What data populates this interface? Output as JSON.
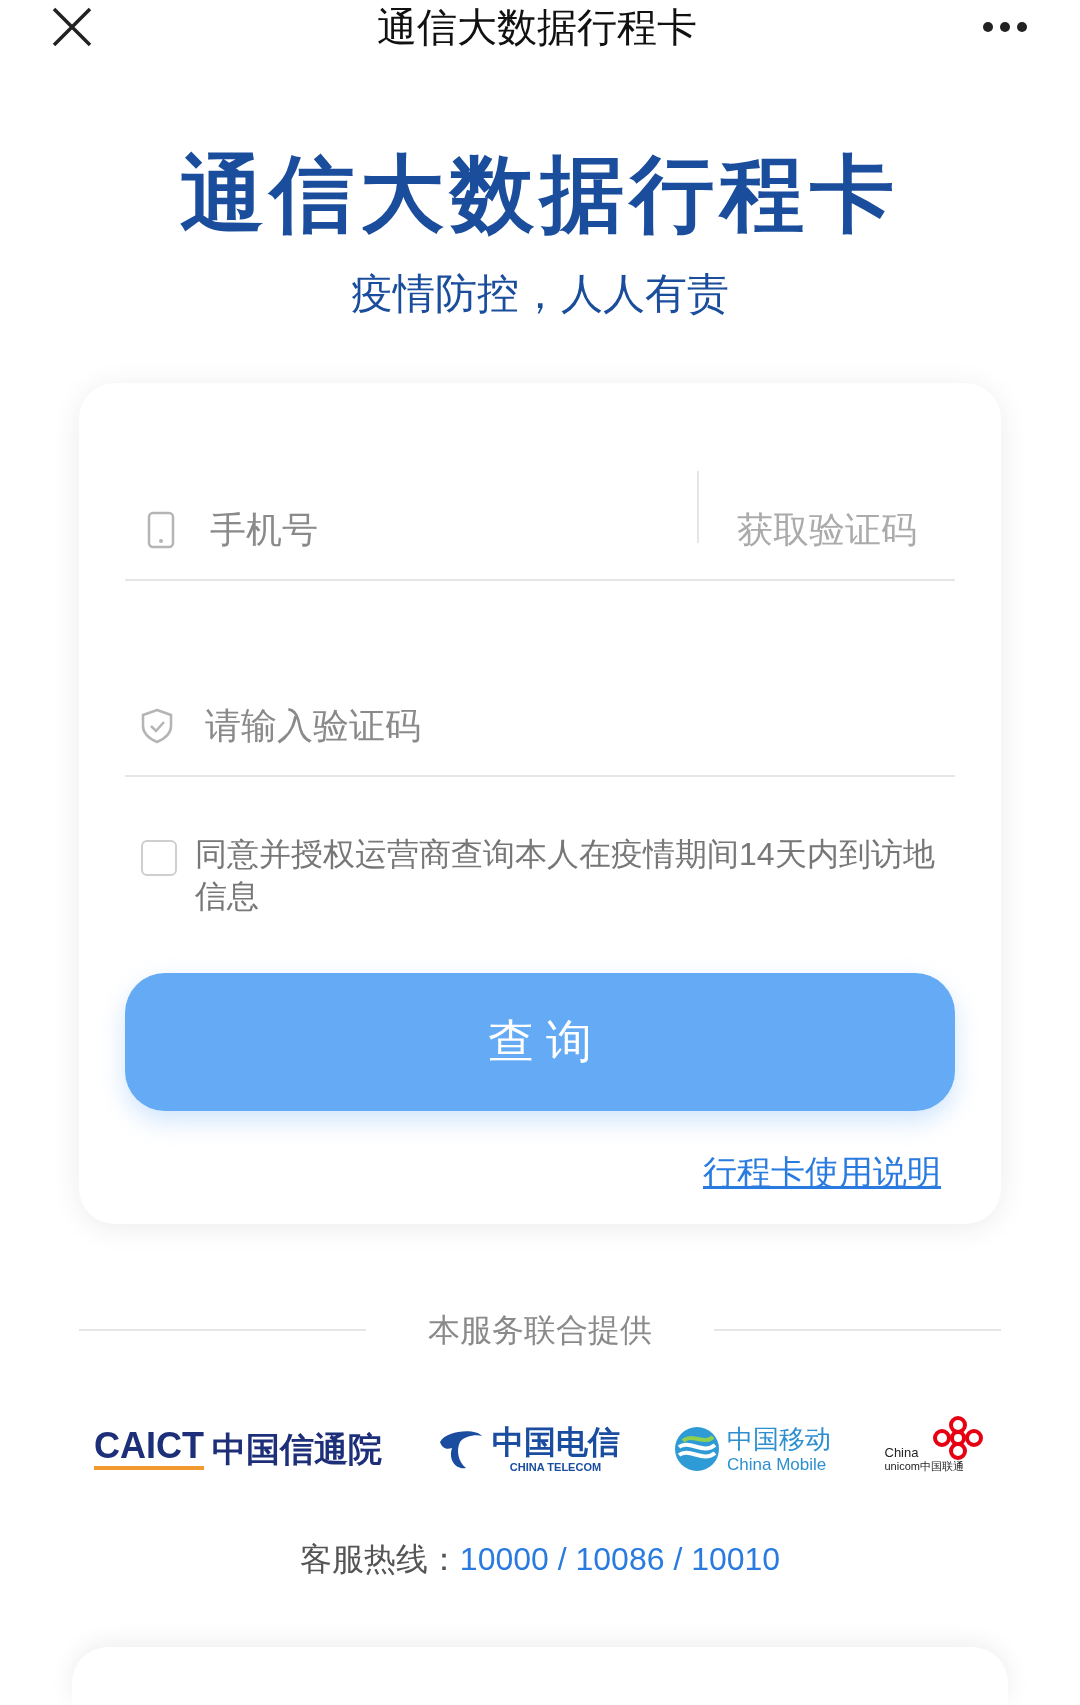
{
  "top_bar": {
    "title": "通信大数据行程卡"
  },
  "header": {
    "title": "通信大数据行程卡",
    "slogan": "疫情防控，人人有责"
  },
  "form": {
    "phone_field": {
      "placeholder": "手机号"
    },
    "get_code_button": "获取验证码",
    "code_field": {
      "placeholder": "请输入验证码"
    },
    "consent": {
      "checked": false,
      "label": "同意并授权运营商查询本人在疫情期间14天内到访地信息"
    },
    "query_button": "查 询",
    "help_link": "行程卡使用说明"
  },
  "providers": {
    "heading": "本服务联合提供",
    "logos": [
      {
        "kind": "caict",
        "texts": [
          "CAICT",
          "中国信通院"
        ]
      },
      {
        "kind": "telecom",
        "texts": [
          "中国电信",
          "CHINA TELECOM"
        ]
      },
      {
        "kind": "mobile",
        "texts": [
          "中国移动",
          "China Mobile"
        ]
      },
      {
        "kind": "unicom",
        "texts": [
          "China",
          "unicom中国联通"
        ]
      }
    ]
  },
  "hotline": {
    "label": "客服热线：",
    "numbers": "10000 / 10086 / 10010"
  }
}
